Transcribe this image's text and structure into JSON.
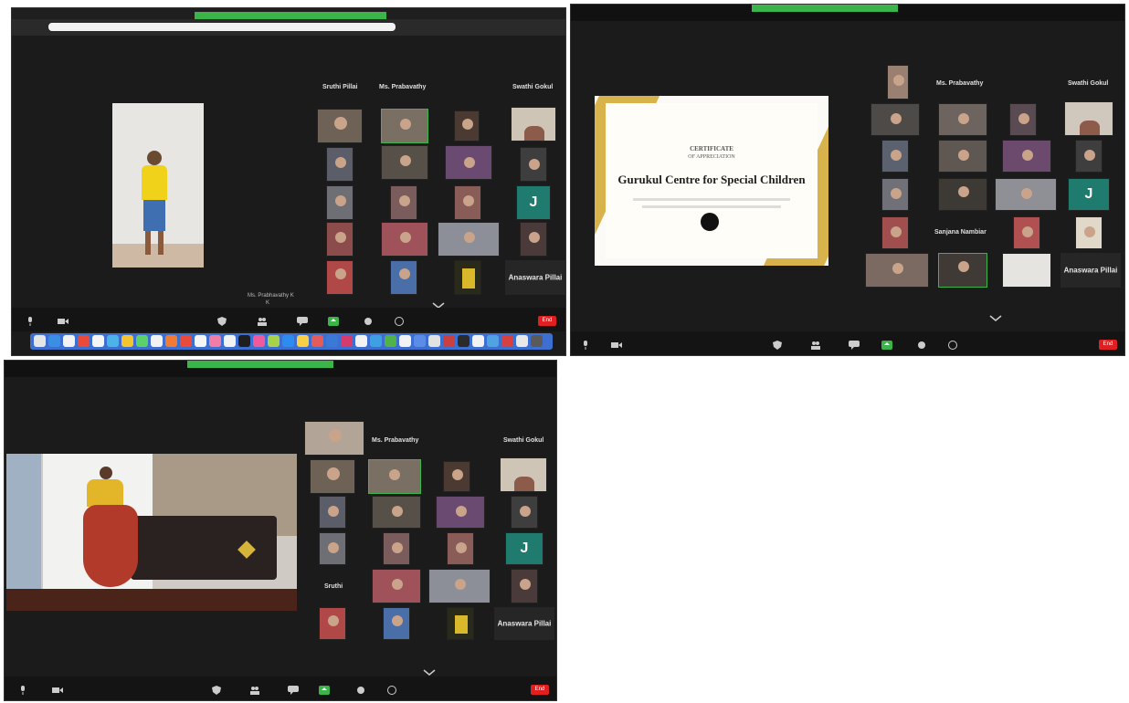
{
  "screens": [
    {
      "host_name": "Ms. Prabhavathy K",
      "name_label_single": "K",
      "header_names": [
        "Sruthi Pillai",
        "Ms. Prabavathy",
        "Swathi Gokul"
      ],
      "tile_text": {
        "teal_letter": "J",
        "name_tile": "Anaswara Pillai"
      },
      "end_label": "End"
    },
    {
      "certificate": {
        "heading": "CERTIFICATE",
        "subheading": "OF APPRECIATION",
        "title": "Gurukul Centre for Special Children"
      },
      "header_names": [
        "Ms. Prabavathy",
        "Swathi Gokul"
      ],
      "tile_text": {
        "teal_letter": "J",
        "name_tile": "Anaswara Pillai",
        "mid_label": "Sanjana Nambiar"
      },
      "end_label": "End"
    },
    {
      "header_names": [
        "Ms. Prabavathy",
        "Swathi Gokul"
      ],
      "tile_text": {
        "teal_letter": "J",
        "name_tile": "Anaswara Pillai",
        "small_label": "Sruthi"
      },
      "end_label": "End"
    }
  ],
  "colors": {
    "zoom_bg": "#1b1b1b",
    "active_speaker": "#3bb54a",
    "end_button": "#e02020",
    "teal_tile": "#1e7b6e"
  },
  "icons": [
    "microphone-icon",
    "video-camera-icon",
    "security-icon",
    "participants-icon",
    "chat-icon",
    "share-screen-icon",
    "record-icon",
    "reactions-icon",
    "chevron-down-icon"
  ]
}
